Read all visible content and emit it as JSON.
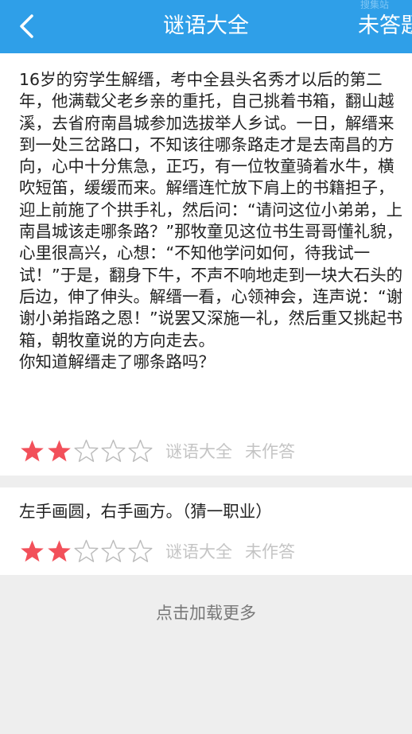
{
  "header": {
    "title": "谜语大全",
    "right_button": "未答题",
    "watermark": "搜集站"
  },
  "riddles": [
    {
      "text": "16岁的穷学生解缙，考中全县头名秀才以后的第二年，他满载父老乡亲的重托，自己挑着书箱，翻山越溪，去省府南昌城参加选拔举人乡试。一日，解缙来到一处三岔路口，不知该往哪条路走才是去南昌的方向，心中十分焦急，正巧，有一位牧童骑着水牛，横吹短笛，缓缓而来。解缙连忙放下肩上的书籍担子，迎上前施了个拱手礼，然后问：“请问这位小弟弟，上南昌城该走哪条路？”那牧童见这位书生哥哥懂礼貌，心里很高兴，心想：“不知他学问如何，待我试一试！”于是，翻身下牛，不声不响地走到一块大石头的后边，伸了伸头。解缙一看，心领神会，连声说：“谢谢小弟指路之恩！”说罢又深施一礼，然后重又挑起书箱，朝牧童说的方向走去。\n你知道解缙走了哪条路吗？",
      "rating": 2,
      "max_rating": 5,
      "category": "谜语大全",
      "status": "未作答"
    },
    {
      "text": "左手画圆，右手画方。（猜一职业）",
      "rating": 2,
      "max_rating": 5,
      "category": "谜语大全",
      "status": "未作答"
    }
  ],
  "load_more": "点击加载更多",
  "colors": {
    "header_bg": "#2f9fe8",
    "star_filled": "#f2505a",
    "star_empty_stroke": "#bbbbbb"
  }
}
